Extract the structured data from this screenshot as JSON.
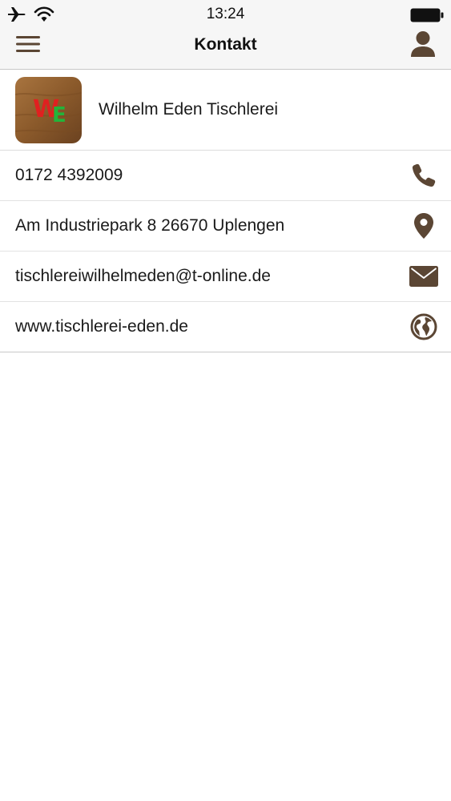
{
  "status_bar": {
    "time": "13:24",
    "icons": [
      "airplane-icon",
      "wifi-icon",
      "battery-icon"
    ]
  },
  "nav": {
    "title": "Kontakt",
    "left_icon": "menu-icon",
    "right_icon": "user-icon"
  },
  "company": {
    "name": "Wilhelm Eden Tischlerei",
    "logo_text": "WE"
  },
  "contacts": [
    {
      "type": "phone",
      "text": "0172 4392009",
      "icon": "phone-icon"
    },
    {
      "type": "address",
      "text": "Am Industriepark 8 26670 Uplengen",
      "icon": "location-pin-icon"
    },
    {
      "type": "email",
      "text": "tischlereiwilhelmeden@t-online.de",
      "icon": "envelope-icon"
    },
    {
      "type": "website",
      "text": "www.tischlerei-eden.de",
      "icon": "globe-icon"
    }
  ],
  "colors": {
    "icon_brown": "#5b4634",
    "nav_background": "#f6f6f6",
    "logo_wood": "#8b5a2b",
    "logo_red": "#e02020",
    "logo_green": "#22b43a"
  }
}
